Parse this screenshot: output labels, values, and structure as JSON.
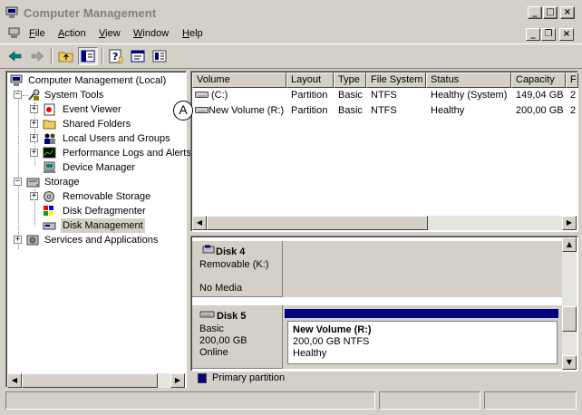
{
  "window": {
    "title": "Computer Management"
  },
  "menu": {
    "items": [
      {
        "underline": "F",
        "rest": "ile"
      },
      {
        "underline": "A",
        "rest": "ction"
      },
      {
        "underline": "V",
        "rest": "iew"
      },
      {
        "underline": "W",
        "rest": "indow"
      },
      {
        "underline": "H",
        "rest": "elp"
      }
    ]
  },
  "tree": {
    "nodes": [
      {
        "label": "Computer Management (Local)",
        "icon": "computer-icon"
      },
      {
        "label": "System Tools",
        "icon": "tools-icon"
      },
      {
        "label": "Event Viewer",
        "icon": "event-viewer-icon"
      },
      {
        "label": "Shared Folders",
        "icon": "folder-icon"
      },
      {
        "label": "Local Users and Groups",
        "icon": "users-icon"
      },
      {
        "label": "Performance Logs and Alerts",
        "icon": "performance-icon"
      },
      {
        "label": "Device Manager",
        "icon": "device-manager-icon"
      },
      {
        "label": "Storage",
        "icon": "storage-icon"
      },
      {
        "label": "Removable Storage",
        "icon": "removable-storage-icon"
      },
      {
        "label": "Disk Defragmenter",
        "icon": "defragmenter-icon"
      },
      {
        "label": "Disk Management",
        "icon": "disk-management-icon"
      },
      {
        "label": "Services and Applications",
        "icon": "services-icon"
      }
    ]
  },
  "volumes": {
    "columns": [
      "Volume",
      "Layout",
      "Type",
      "File System",
      "Status",
      "Capacity",
      "F"
    ],
    "rows": [
      {
        "volume": "(C:)",
        "layout": "Partition",
        "type": "Basic",
        "fs": "NTFS",
        "status": "Healthy (System)",
        "capacity": "149,04 GB",
        "free": "2"
      },
      {
        "volume": "New Volume (R:)",
        "layout": "Partition",
        "type": "Basic",
        "fs": "NTFS",
        "status": "Healthy",
        "capacity": "200,00 GB",
        "free": "2"
      }
    ]
  },
  "disks": [
    {
      "name": "Disk 4",
      "kind": "Removable (K:)",
      "size": "",
      "state": "No Media"
    },
    {
      "name": "Disk 5",
      "kind": "Basic",
      "size": "200,00 GB",
      "state": "Online",
      "partition": {
        "name": "New Volume  (R:)",
        "detail": "200,00 GB NTFS",
        "status": "Healthy"
      }
    }
  ],
  "legend": {
    "label": "Primary partition"
  },
  "callout": {
    "label": "A"
  },
  "colors": {
    "primary_partition": "#000080",
    "chrome": "#d4d0c8"
  }
}
